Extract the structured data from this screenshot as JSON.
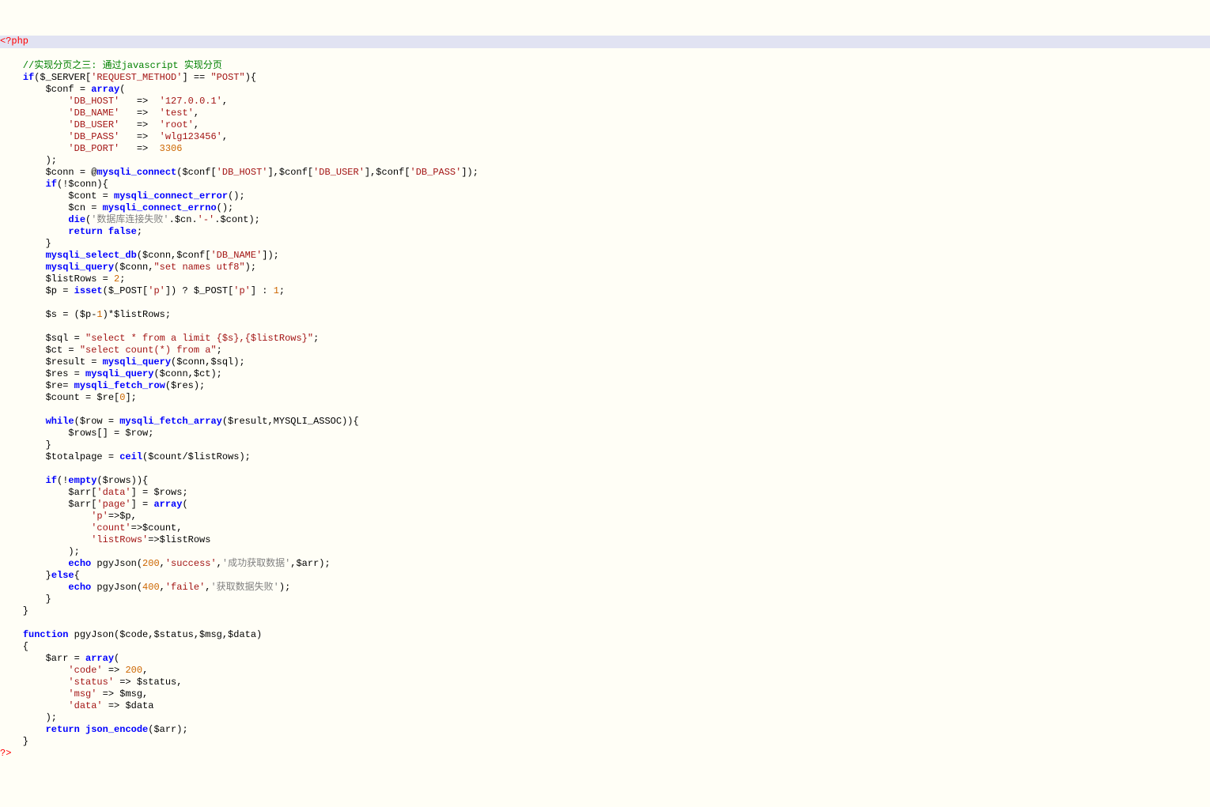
{
  "code": {
    "l1": "<?php",
    "l2_1": "    //实现分页之三: 通过javascript 实现分页",
    "l3_1": "    ",
    "l3_2": "if",
    "l3_3": "($_SERVER[",
    "l3_4": "'REQUEST_METHOD'",
    "l3_5": "] == ",
    "l3_6": "\"POST\"",
    "l3_7": "){",
    "l4_1": "        $conf = ",
    "l4_2": "array",
    "l4_3": "(",
    "l5_1": "            ",
    "l5_2": "'DB_HOST'",
    "l5_3": "   =>  ",
    "l5_4": "'127.0.0.1'",
    "l5_5": ",",
    "l6_1": "            ",
    "l6_2": "'DB_NAME'",
    "l6_3": "   =>  ",
    "l6_4": "'test'",
    "l6_5": ",",
    "l7_1": "            ",
    "l7_2": "'DB_USER'",
    "l7_3": "   =>  ",
    "l7_4": "'root'",
    "l7_5": ",",
    "l8_1": "            ",
    "l8_2": "'DB_PASS'",
    "l8_3": "   =>  ",
    "l8_4": "'wlg123456'",
    "l8_5": ",",
    "l9_1": "            ",
    "l9_2": "'DB_PORT'",
    "l9_3": "   =>  ",
    "l9_4": "3306",
    "l10": "        );",
    "l11_1": "        $conn = @",
    "l11_2": "mysqli_connect",
    "l11_3": "($conf[",
    "l11_4": "'DB_HOST'",
    "l11_5": "],$conf[",
    "l11_6": "'DB_USER'",
    "l11_7": "],$conf[",
    "l11_8": "'DB_PASS'",
    "l11_9": "]);",
    "l12_1": "        ",
    "l12_2": "if",
    "l12_3": "(!$conn){",
    "l13_1": "            $cont = ",
    "l13_2": "mysqli_connect_error",
    "l13_3": "();",
    "l14_1": "            $cn = ",
    "l14_2": "mysqli_connect_errno",
    "l14_3": "();",
    "l15_1": "            ",
    "l15_2": "die",
    "l15_3": "(",
    "l15_4": "'数据库连接失败'",
    "l15_5": ".$cn.",
    "l15_6": "'-'",
    "l15_7": ".$cont);",
    "l16_1": "            ",
    "l16_2": "return false",
    "l16_3": ";",
    "l17": "        }",
    "l18_1": "        ",
    "l18_2": "mysqli_select_db",
    "l18_3": "($conn,$conf[",
    "l18_4": "'DB_NAME'",
    "l18_5": "]);",
    "l19_1": "        ",
    "l19_2": "mysqli_query",
    "l19_3": "($conn,",
    "l19_4": "\"set names utf8\"",
    "l19_5": ");",
    "l20_1": "        $listRows = ",
    "l20_2": "2",
    "l20_3": ";",
    "l21_1": "        $p = ",
    "l21_2": "isset",
    "l21_3": "($_POST[",
    "l21_4": "'p'",
    "l21_5": "]) ? $_POST[",
    "l21_6": "'p'",
    "l21_7": "] : ",
    "l21_8": "1",
    "l21_9": ";",
    "l22": "",
    "l23_1": "        $s = ($p-",
    "l23_2": "1",
    "l23_3": ")*$listRows;",
    "l24": "",
    "l25_1": "        $sql = ",
    "l25_2": "\"select * from a limit {$s},{$listRows}\"",
    "l25_3": ";",
    "l26_1": "        $ct = ",
    "l26_2": "\"select count(*) from a\"",
    "l26_3": ";",
    "l27_1": "        $result = ",
    "l27_2": "mysqli_query",
    "l27_3": "($conn,$sql);",
    "l28_1": "        $res = ",
    "l28_2": "mysqli_query",
    "l28_3": "($conn,$ct);",
    "l29_1": "        $re= ",
    "l29_2": "mysqli_fetch_row",
    "l29_3": "($res);",
    "l30_1": "        $count = $re[",
    "l30_2": "0",
    "l30_3": "];",
    "l31": "",
    "l32_1": "        ",
    "l32_2": "while",
    "l32_3": "($row = ",
    "l32_4": "mysqli_fetch_array",
    "l32_5": "($result,MYSQLI_ASSOC)){",
    "l33": "            $rows[] = $row;",
    "l34": "        }",
    "l35_1": "        $totalpage = ",
    "l35_2": "ceil",
    "l35_3": "($count/$listRows);",
    "l36": "",
    "l37_1": "        ",
    "l37_2": "if",
    "l37_3": "(!",
    "l37_4": "empty",
    "l37_5": "($rows)){",
    "l38_1": "            $arr[",
    "l38_2": "'data'",
    "l38_3": "] = $rows;",
    "l39_1": "            $arr[",
    "l39_2": "'page'",
    "l39_3": "] = ",
    "l39_4": "array",
    "l39_5": "(",
    "l40_1": "                ",
    "l40_2": "'p'",
    "l40_3": "=>$p,",
    "l41_1": "                ",
    "l41_2": "'count'",
    "l41_3": "=>$count,",
    "l42_1": "                ",
    "l42_2": "'listRows'",
    "l42_3": "=>$listRows",
    "l43": "            );",
    "l44_1": "            ",
    "l44_2": "echo",
    "l44_3": " pgyJson(",
    "l44_4": "200",
    "l44_5": ",",
    "l44_6": "'success'",
    "l44_7": ",",
    "l44_8": "'成功获取数据'",
    "l44_9": ",$arr);",
    "l45_1": "        }",
    "l45_2": "else",
    "l45_3": "{",
    "l46_1": "            ",
    "l46_2": "echo",
    "l46_3": " pgyJson(",
    "l46_4": "400",
    "l46_5": ",",
    "l46_6": "'faile'",
    "l46_7": ",",
    "l46_8": "'获取数据失败'",
    "l46_9": ");",
    "l47": "        }",
    "l48": "    }",
    "l49": "",
    "l50_1": "    ",
    "l50_2": "function",
    "l50_3": " pgyJson($code,$status,$msg,$data)",
    "l51": "    {",
    "l52_1": "        $arr = ",
    "l52_2": "array",
    "l52_3": "(",
    "l53_1": "            ",
    "l53_2": "'code'",
    "l53_3": " => ",
    "l53_4": "200",
    "l53_5": ",",
    "l54_1": "            ",
    "l54_2": "'status'",
    "l54_3": " => $status,",
    "l55_1": "            ",
    "l55_2": "'msg'",
    "l55_3": " => $msg,",
    "l56_1": "            ",
    "l56_2": "'data'",
    "l56_3": " => $data",
    "l57": "        );",
    "l58_1": "        ",
    "l58_2": "return",
    "l58_3": " ",
    "l58_4": "json_encode",
    "l58_5": "($arr);",
    "l59": "    }",
    "l60": "?>"
  }
}
